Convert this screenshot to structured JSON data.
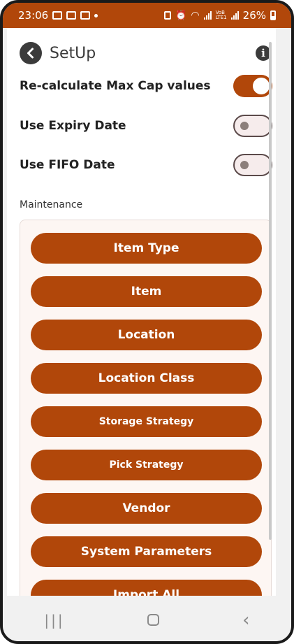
{
  "status_bar": {
    "time": "23:06",
    "battery_percent": "26%",
    "icons": [
      "mail-icon",
      "gallery-icon",
      "youtube-icon",
      "notification-dot",
      "battery-saver-icon",
      "alarm-icon",
      "wifi-icon",
      "signal-icon",
      "volte-icon",
      "signal-icon",
      "battery-icon"
    ],
    "volte_label_1": "VoB",
    "volte_label_2": "LTE1"
  },
  "header": {
    "title": "SetUp",
    "back_icon": "back-arrow-icon",
    "info_icon": "info-icon",
    "info_glyph": "i"
  },
  "settings": [
    {
      "label": "Re-calculate Max Cap values",
      "state": "on"
    },
    {
      "label": "Use Expiry Date",
      "state": "off"
    },
    {
      "label": "Use FIFO Date",
      "state": "off"
    }
  ],
  "maintenance": {
    "label": "Maintenance",
    "buttons": [
      "Item Type",
      "Item",
      "Location",
      "Location Class",
      "Storage Strategy",
      "Pick Strategy",
      "Vendor",
      "System Parameters",
      "Import All"
    ]
  },
  "nav_bar": {
    "recents_icon": "recents-icon",
    "home_icon": "home-icon",
    "back_icon": "nav-back-icon"
  },
  "colors": {
    "accent": "#b1470a",
    "dark": "#3b3b3b",
    "panel_bg": "#fdf6f3",
    "switch_off_bg": "#f6ecec"
  }
}
